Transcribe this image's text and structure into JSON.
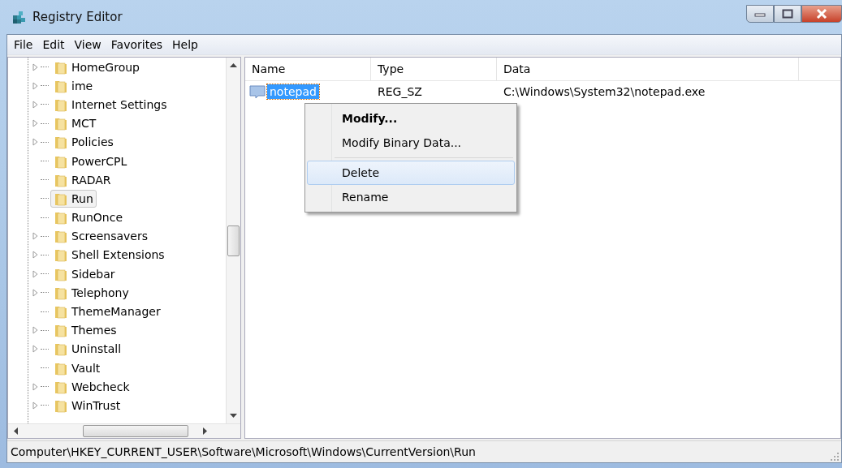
{
  "window": {
    "title": "Registry Editor"
  },
  "menu_bar": [
    "File",
    "Edit",
    "View",
    "Favorites",
    "Help"
  ],
  "tree": {
    "items": [
      {
        "label": "HomeGroup",
        "expandable": true,
        "selected": false
      },
      {
        "label": "ime",
        "expandable": true,
        "selected": false
      },
      {
        "label": "Internet Settings",
        "expandable": true,
        "selected": false
      },
      {
        "label": "MCT",
        "expandable": true,
        "selected": false
      },
      {
        "label": "Policies",
        "expandable": true,
        "selected": false
      },
      {
        "label": "PowerCPL",
        "expandable": false,
        "selected": false
      },
      {
        "label": "RADAR",
        "expandable": false,
        "selected": false
      },
      {
        "label": "Run",
        "expandable": false,
        "selected": true
      },
      {
        "label": "RunOnce",
        "expandable": false,
        "selected": false
      },
      {
        "label": "Screensavers",
        "expandable": true,
        "selected": false
      },
      {
        "label": "Shell Extensions",
        "expandable": true,
        "selected": false
      },
      {
        "label": "Sidebar",
        "expandable": true,
        "selected": false
      },
      {
        "label": "Telephony",
        "expandable": true,
        "selected": false
      },
      {
        "label": "ThemeManager",
        "expandable": false,
        "selected": false
      },
      {
        "label": "Themes",
        "expandable": true,
        "selected": false
      },
      {
        "label": "Uninstall",
        "expandable": true,
        "selected": false
      },
      {
        "label": "Vault",
        "expandable": false,
        "selected": false
      },
      {
        "label": "Webcheck",
        "expandable": true,
        "selected": false
      },
      {
        "label": "WinTrust",
        "expandable": true,
        "selected": false
      }
    ]
  },
  "table": {
    "columns": [
      "Name",
      "Type",
      "Data"
    ],
    "rows": [
      {
        "name": "notepad",
        "type": "REG_SZ",
        "data": "C:\\Windows\\System32\\notepad.exe",
        "selected": true
      }
    ]
  },
  "context_menu": {
    "items": [
      {
        "label": "Modify...",
        "default": true,
        "selected": false,
        "separator_after": false
      },
      {
        "label": "Modify Binary Data...",
        "default": false,
        "selected": false,
        "separator_after": true
      },
      {
        "label": "Delete",
        "default": false,
        "selected": true,
        "separator_after": false
      },
      {
        "label": "Rename",
        "default": false,
        "selected": false,
        "separator_after": false
      }
    ]
  },
  "status_bar": "Computer\\HKEY_CURRENT_USER\\Software\\Microsoft\\Windows\\CurrentVersion\\Run"
}
